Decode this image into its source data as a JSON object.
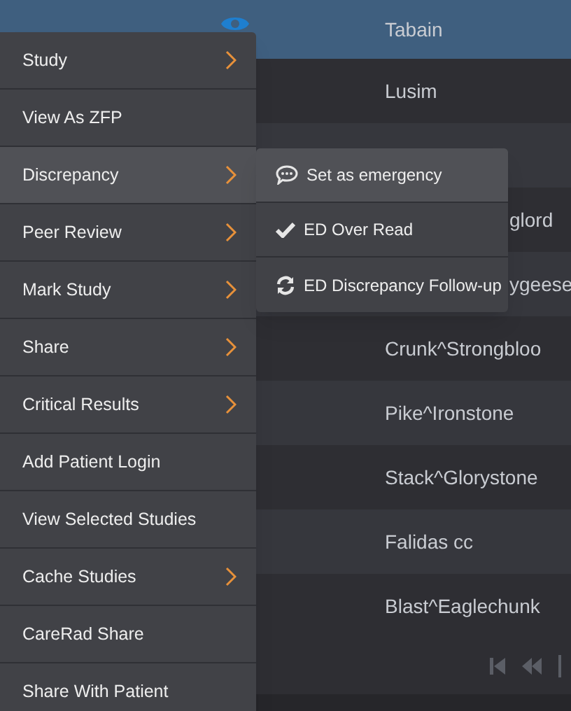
{
  "table": {
    "rows": [
      {
        "name": "Tabain",
        "selected": true,
        "kind": "plain"
      },
      {
        "name": "Lusim",
        "selected": false,
        "kind": "plain"
      },
      {
        "selected": false
      },
      {
        "name": "glord",
        "selected": false,
        "kind": "covered"
      },
      {
        "name": "ygeese",
        "selected": false,
        "kind": "covered"
      },
      {
        "name": "Crunk^Strongbloo",
        "selected": false,
        "kind": "plain"
      },
      {
        "name": "Pike^Ironstone",
        "selected": false,
        "kind": "plain"
      },
      {
        "name": "Stack^Glorystone",
        "selected": false,
        "kind": "plain"
      },
      {
        "name": "Falidas cc",
        "selected": false,
        "kind": "plain"
      },
      {
        "name": "Blast^Eaglechunk",
        "selected": false,
        "kind": "plain"
      }
    ]
  },
  "context_menu": {
    "items": [
      {
        "label": "Study",
        "has_submenu": true,
        "highlighted": false
      },
      {
        "label": "View As ZFP",
        "has_submenu": false,
        "highlighted": false
      },
      {
        "label": "Discrepancy",
        "has_submenu": true,
        "highlighted": true
      },
      {
        "label": "Peer Review",
        "has_submenu": true,
        "highlighted": false
      },
      {
        "label": "Mark Study",
        "has_submenu": true,
        "highlighted": false
      },
      {
        "label": "Share",
        "has_submenu": true,
        "highlighted": false
      },
      {
        "label": "Critical Results",
        "has_submenu": true,
        "highlighted": false
      },
      {
        "label": "Add Patient Login",
        "has_submenu": false,
        "highlighted": false
      },
      {
        "label": "View Selected Studies",
        "has_submenu": false,
        "highlighted": false
      },
      {
        "label": "Cache Studies",
        "has_submenu": true,
        "highlighted": false
      },
      {
        "label": "CareRad Share",
        "has_submenu": false,
        "highlighted": false
      },
      {
        "label": "Share With Patient",
        "has_submenu": false,
        "highlighted": false
      }
    ]
  },
  "submenu": {
    "items": [
      {
        "label": "Set as emergency",
        "kind": "chat",
        "highlighted": true
      },
      {
        "label": "ED Over Read",
        "kind": "check",
        "highlighted": false
      },
      {
        "label": "ED Discrepancy Follow-up",
        "kind": "refresh",
        "highlighted": false
      }
    ]
  }
}
